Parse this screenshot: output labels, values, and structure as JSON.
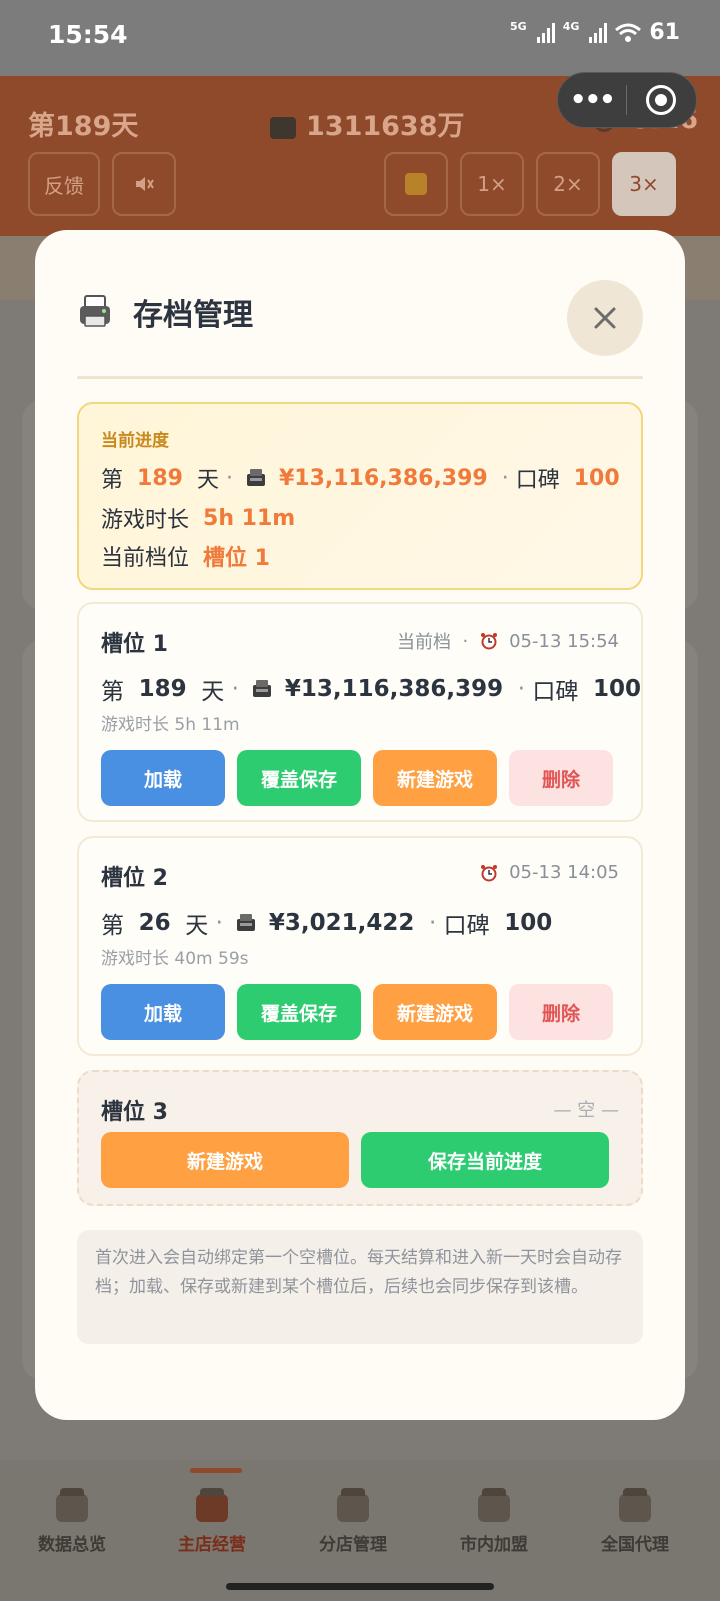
{
  "status_bar": {
    "time": "15:54",
    "sig1": "5G",
    "sig2": "4G",
    "battery": "61"
  },
  "background": {
    "day": "第189天",
    "money": "1311638万",
    "clock": "8:16",
    "feedback": "反馈",
    "speed_1x": "1×",
    "speed_2x": "2×",
    "speed_3x": "3×"
  },
  "modal": {
    "title": "存档管理",
    "current_progress": {
      "label": "当前进度",
      "day_prefix": "第",
      "day": "189",
      "day_suffix": "天",
      "dot": "·",
      "money": "¥13,116,386,399",
      "rep_label": "口碑",
      "rep": "100",
      "playtime_label": "游戏时长",
      "playtime": "5h 11m",
      "slot_label": "当前档位",
      "slot": "槽位 1"
    },
    "slots": [
      {
        "name": "槽位 1",
        "current_tag": "当前档",
        "dot": "·",
        "timestamp": "05-13 15:54",
        "day_prefix": "第",
        "day": "189",
        "day_suffix": "天",
        "money": "¥13,116,386,399",
        "rep_label": "口碑",
        "rep": "100",
        "playtime": "游戏时长 5h 11m",
        "load": "加载",
        "overwrite": "覆盖保存",
        "new_game": "新建游戏",
        "delete": "删除"
      },
      {
        "name": "槽位 2",
        "dot": "·",
        "timestamp": "05-13 14:05",
        "day_prefix": "第",
        "day": "26",
        "day_suffix": "天",
        "money": "¥3,021,422",
        "rep_label": "口碑",
        "rep": "100",
        "playtime": "游戏时长 40m 59s",
        "load": "加载",
        "overwrite": "覆盖保存",
        "new_game": "新建游戏",
        "delete": "删除"
      },
      {
        "name": "槽位 3",
        "empty_tag": "— 空 —",
        "new_game": "新建游戏",
        "save_current": "保存当前进度"
      }
    ],
    "note": "首次进入会自动绑定第一个空槽位。每天结算和进入新一天时会自动存档；加载、保存或新建到某个槽位后，后续也会同步保存到该槽。"
  },
  "bottom_nav": [
    {
      "label": "数据总览"
    },
    {
      "label": "主店经营"
    },
    {
      "label": "分店管理"
    },
    {
      "label": "市内加盟"
    },
    {
      "label": "全国代理"
    }
  ]
}
